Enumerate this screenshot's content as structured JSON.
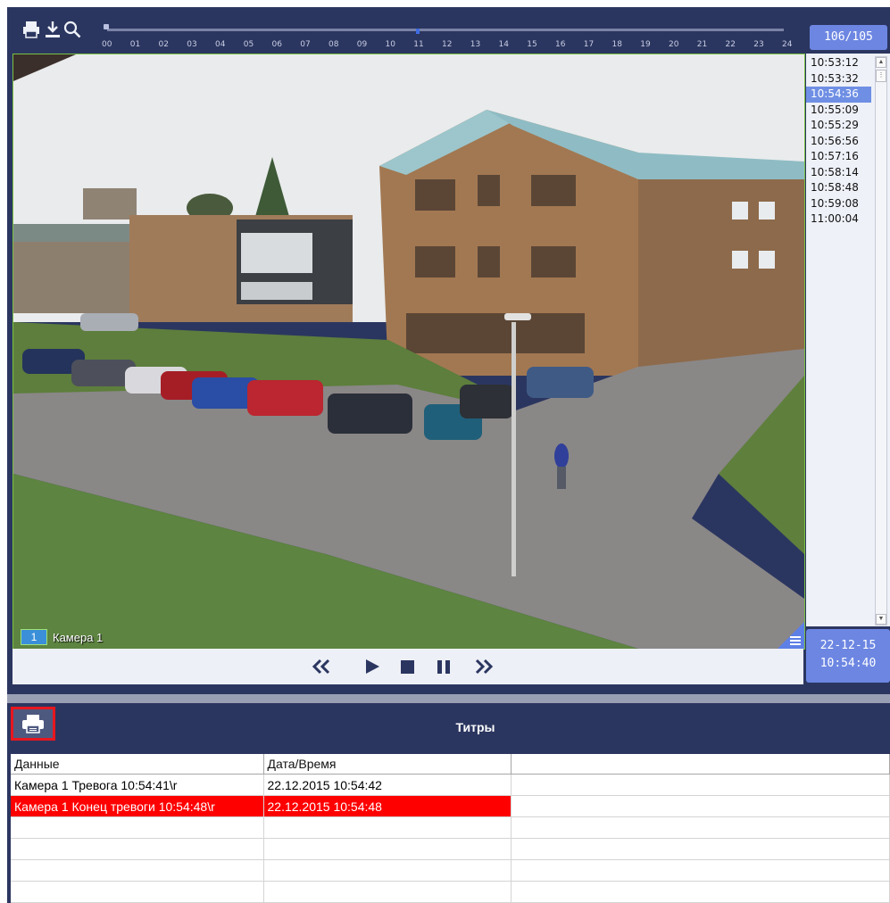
{
  "player": {
    "counter": "106/105",
    "timeline_hours": [
      "00",
      "01",
      "02",
      "03",
      "04",
      "05",
      "06",
      "07",
      "08",
      "09",
      "10",
      "11",
      "12",
      "13",
      "14",
      "15",
      "16",
      "17",
      "18",
      "19",
      "20",
      "21",
      "22",
      "23",
      "24"
    ],
    "camera": {
      "number": "1",
      "name": "Камера 1"
    },
    "time_list": [
      "10:53:12",
      "10:53:32",
      "10:54:36",
      "10:55:09",
      "10:55:29",
      "10:56:56",
      "10:57:16",
      "10:58:14",
      "10:58:48",
      "10:59:08",
      "11:00:04"
    ],
    "selected_time": "10:54:36",
    "date": "22-12-15",
    "time": "10:54:40",
    "colors": {
      "panel": "#2b3660",
      "accent": "#6c86e2",
      "frame": "#7ac142"
    },
    "icons": [
      "print-icon",
      "download-icon",
      "search-icon",
      "rewind-icon",
      "play-icon",
      "stop-icon",
      "pause-icon",
      "fast-forward-icon",
      "menu-icon"
    ]
  },
  "titles": {
    "heading": "Титры",
    "columns": [
      "Данные",
      "Дата/Время",
      ""
    ],
    "rows": [
      {
        "data": "Камера 1 Тревога 10:54:41\\r",
        "datetime": "22.12.2015 10:54:42",
        "alarm": false
      },
      {
        "data": "Камера 1 Конец тревоги 10:54:48\\r",
        "datetime": "22.12.2015 10:54:48",
        "alarm": true
      },
      {
        "data": "",
        "datetime": "",
        "alarm": false
      },
      {
        "data": "",
        "datetime": "",
        "alarm": false
      },
      {
        "data": "",
        "datetime": "",
        "alarm": false
      },
      {
        "data": "",
        "datetime": "",
        "alarm": false
      }
    ],
    "colors": {
      "alarm_row": "#ff0000",
      "print_button_border": "#e8171f"
    }
  }
}
